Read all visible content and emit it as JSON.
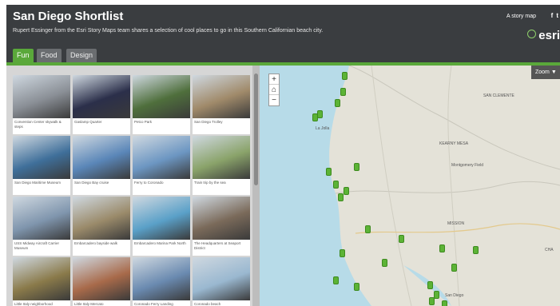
{
  "header": {
    "title": "San Diego Shortlist",
    "subtitle": "Rupert Essinger from the Esri Story Maps team shares a selection of cool places to go in this Southern Californian beach city.",
    "story_link": "A story map",
    "esri_logo": "esri"
  },
  "tabs": [
    {
      "label": "Fun",
      "active": true
    },
    {
      "label": "Food",
      "active": false
    },
    {
      "label": "Design",
      "active": false
    }
  ],
  "gallery": {
    "items": [
      {
        "caption": "Convention Center skywalk & steps",
        "color": "#8a8f96"
      },
      {
        "caption": "Gaslamp Quarter",
        "color": "#2b2f4a"
      },
      {
        "caption": "Petco Park",
        "color": "#4f6f3c"
      },
      {
        "caption": "San Diego Trolley",
        "color": "#a08a6a"
      },
      {
        "caption": "San Diego Maritime Museum",
        "color": "#3f6f9a"
      },
      {
        "caption": "San Diego Bay cruise",
        "color": "#5a86b8"
      },
      {
        "caption": "Ferry to Coronado",
        "color": "#6c96c2"
      },
      {
        "caption": "Train trip by the sea",
        "color": "#8aa36a"
      },
      {
        "caption": "USS Midway Aircraft Carrier Museum",
        "color": "#7f95ad"
      },
      {
        "caption": "Embarcadero bayside walk",
        "color": "#9a8a6a"
      },
      {
        "caption": "Embarcadero Marina Park North",
        "color": "#5aa0c8"
      },
      {
        "caption": "The Headquarters at Seaport District",
        "color": "#7a6a5a"
      },
      {
        "caption": "Little Italy neighborhood",
        "color": "#8a7a4a"
      },
      {
        "caption": "Little Italy Mercato",
        "color": "#a86a4a"
      },
      {
        "caption": "Coronado Ferry Landing",
        "color": "#6a8ab0"
      },
      {
        "caption": "Coronado beach",
        "color": "#9ab8d0"
      }
    ]
  },
  "map": {
    "zoom_in": "+",
    "home": "⌂",
    "zoom_out": "−",
    "zoom_label": "Zoom ▼",
    "labels": [
      {
        "text": "La Jolla"
      },
      {
        "text": "KEARNY MESA"
      },
      {
        "text": "MISSION"
      },
      {
        "text": "Montgomery Field"
      },
      {
        "text": "SAN CLEMENTE"
      },
      {
        "text": "San Diego"
      },
      {
        "text": "CHA"
      }
    ],
    "colors": {
      "land": "#e4e2d8",
      "water": "#b7dbe8",
      "pin": "#5cb336"
    }
  }
}
